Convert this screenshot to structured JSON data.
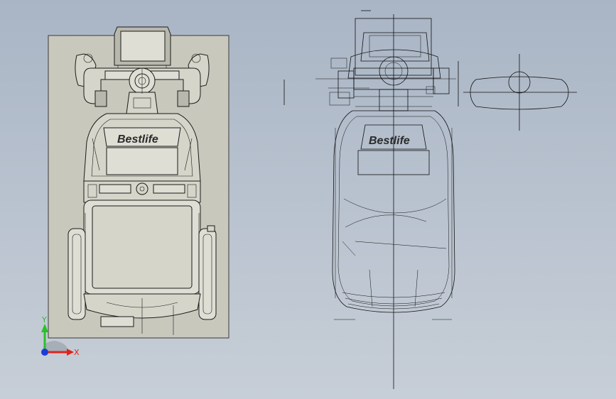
{
  "drawing": {
    "brand_text": "Bestlife"
  },
  "triad": {
    "x_label": "X",
    "y_label": "Y",
    "x_color": "#e0231c",
    "y_color": "#2bbf2b",
    "z_color": "#1a3cd8"
  },
  "views": [
    "top-view-shaded",
    "front-view-wireframe",
    "side-view-wireframe"
  ]
}
